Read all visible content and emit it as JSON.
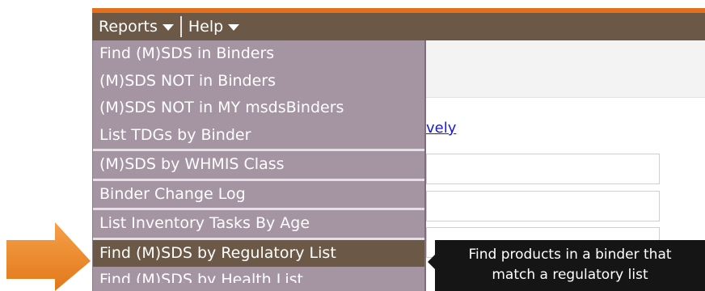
{
  "menubar": {
    "items": [
      {
        "label": "Reports"
      },
      {
        "label": "Help"
      }
    ]
  },
  "background": {
    "link_fragment": "vely"
  },
  "reports_menu": {
    "items": [
      {
        "label": "Find (M)SDS in Binders"
      },
      {
        "label": "(M)SDS NOT in Binders"
      },
      {
        "label": "(M)SDS NOT in MY msdsBinders"
      },
      {
        "label": "List TDGs by Binder"
      },
      {
        "label": "(M)SDS by WHMIS Class"
      },
      {
        "label": "Binder Change Log"
      },
      {
        "label": "List Inventory Tasks By Age"
      },
      {
        "label": "Find (M)SDS by Regulatory List"
      },
      {
        "label": "Find (M)SDS by Health List"
      }
    ]
  },
  "tooltip": {
    "line1": "Find products in a binder that",
    "line2": "match a regulatory list"
  },
  "colors": {
    "menubar": "#6b5847",
    "accent": "#e4701e",
    "dropdown": "#a595a2",
    "tooltip": "#151515",
    "pointer_arrow": "#ee8a2a"
  }
}
